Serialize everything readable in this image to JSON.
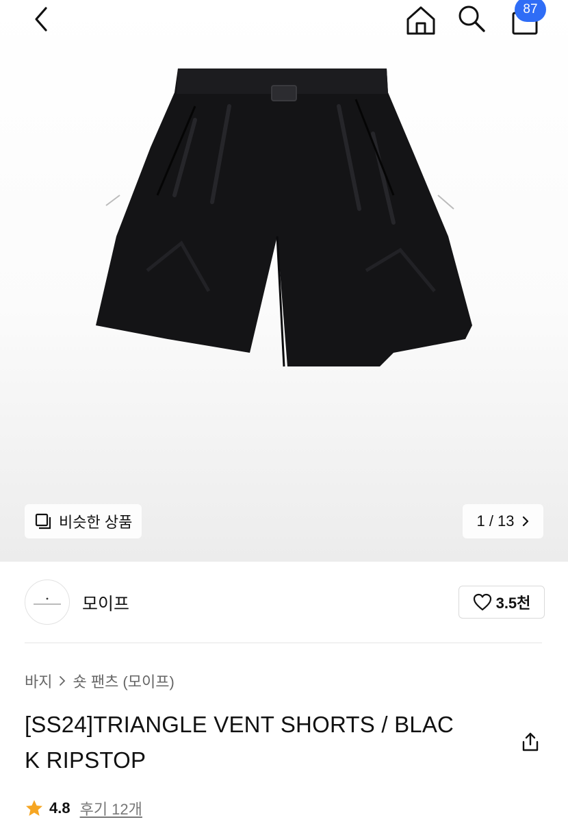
{
  "header": {
    "cart_count": "87",
    "icons": [
      "back-chevron-icon",
      "home-icon",
      "search-icon",
      "shopping-bag-icon"
    ]
  },
  "gallery": {
    "similar_label": "비슷한 상품",
    "counter": "1 / 13"
  },
  "brand": {
    "name": "모이프",
    "likes": "3.5천"
  },
  "breadcrumb": {
    "items": [
      "바지",
      "숏 팬츠 (모이프)"
    ]
  },
  "product": {
    "title_line1": "[SS24]TRIANGLE VENT SHORTS / BLAC",
    "title_line2": "K RIPSTOP",
    "rating": "4.8",
    "reviews": "후기 12개"
  },
  "colors": {
    "badge": "#2f6df6",
    "star": "#f6a623"
  }
}
